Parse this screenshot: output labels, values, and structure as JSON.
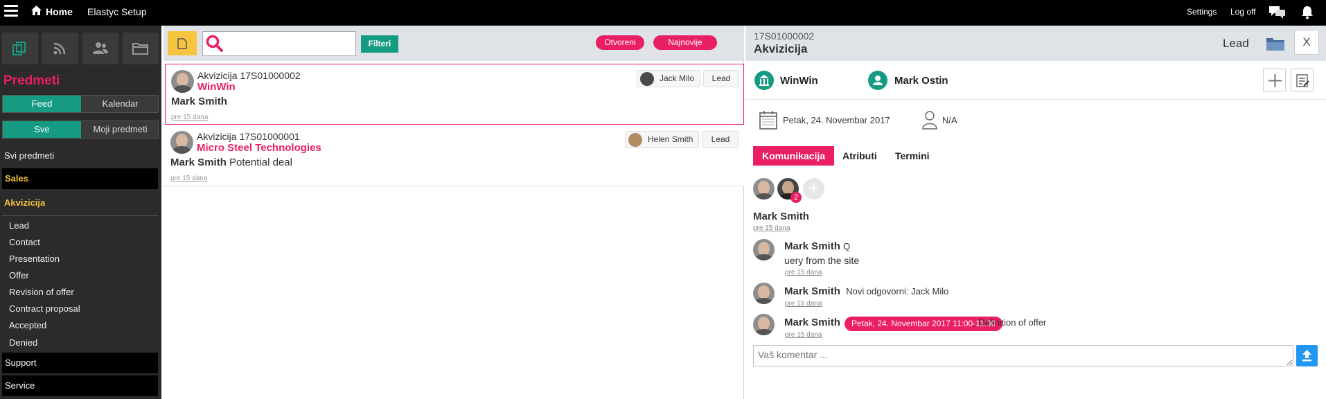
{
  "topbar": {
    "home": "Home",
    "setup": "Elastyc Setup",
    "settings": "Settings",
    "logoff": "Log off"
  },
  "sidebar": {
    "icons": [
      "documents-icon",
      "rss-icon",
      "contacts-icon",
      "folder-icon"
    ],
    "title": "Predmeti",
    "view_toggle": [
      "Feed",
      "Kalendar"
    ],
    "scope_toggle": [
      "Sve",
      "Moji predmeti"
    ],
    "all_items": "Svi predmeti",
    "sales": "Sales",
    "akvizicija": "Akvizicija",
    "stages": [
      "Lead",
      "Contact",
      "Presentation",
      "Offer",
      "Revision of offer",
      "Contract proposal",
      "Accepted",
      "Denied"
    ],
    "support": "Support",
    "service": "Service"
  },
  "toolbar": {
    "search_placeholder": "",
    "filter": "Filteri",
    "open": "Otvoreni",
    "newest": "Najnovije"
  },
  "feed": [
    {
      "title": "Akvizicija 17S01000002",
      "company": "WinWin",
      "person": "Mark Smith",
      "note": "",
      "time": "pre 15 dana",
      "assignee": "Jack Milo",
      "stage": "Lead"
    },
    {
      "title": "Akvizicija 17S01000001",
      "company": "Micro Steel Technologies",
      "person": "Mark Smith",
      "note": "Potential deal",
      "time": "pre 15 dana",
      "assignee": "Helen Smith",
      "stage": "Lead"
    }
  ],
  "detail": {
    "number": "17S01000002",
    "title": "Akvizicija",
    "stage": "Lead",
    "close": "X",
    "company": "WinWin",
    "contact": "Mark Ostin",
    "date": "Petak, 24. Novembar 2017",
    "owner": "N/A",
    "tabs": [
      "Komunikacija",
      "Atributi",
      "Termini"
    ],
    "participant_count": "2",
    "creator": "Mark Smith",
    "creator_time": "pre 15 dana",
    "messages": [
      {
        "author": "Mark Smith",
        "text": "Q",
        "text2": "uery from the site",
        "time": "pre 15 dana"
      },
      {
        "author": "Mark Smith",
        "text": "Novi odgovorni: Jack Milo",
        "time": "pre 15 dana"
      },
      {
        "author": "Mark Smith",
        "pill": "Petak, 24. Novembar 2017 11:00-11:30",
        "text": ", Definition of offer",
        "time": "pre 15 dana"
      }
    ],
    "comment_placeholder": "Vaš komentar ..."
  },
  "colors": {
    "accent": "#e91e63",
    "teal": "#169b83",
    "yellow": "#f5c542",
    "sidebar_bg": "#2b2b2b",
    "upload_blue": "#2196f3"
  }
}
